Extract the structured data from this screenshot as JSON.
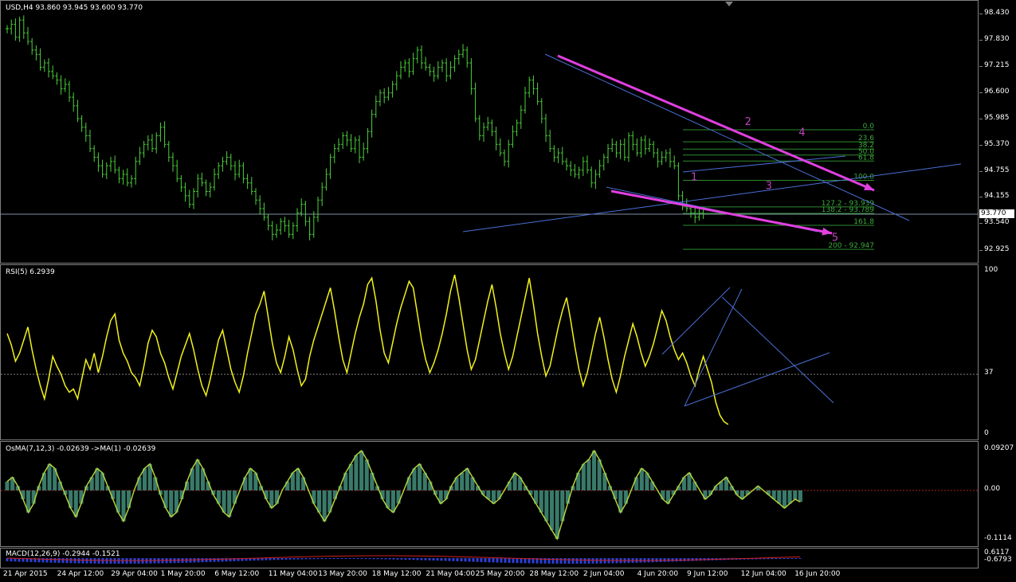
{
  "main": {
    "header": "USD,H4  93.860 93.945 93.600 93.770",
    "price_levels": [
      {
        "label": "98.430",
        "price": 98.43
      },
      {
        "label": "97.830",
        "price": 97.83
      },
      {
        "label": "97.215",
        "price": 97.215
      },
      {
        "label": "96.600",
        "price": 96.6
      },
      {
        "label": "95.985",
        "price": 95.985
      },
      {
        "label": "95.370",
        "price": 95.37
      },
      {
        "label": "94.755",
        "price": 94.755
      },
      {
        "label": "94.155",
        "price": 94.155
      },
      {
        "label": "93.540",
        "price": 93.54
      },
      {
        "label": "92.925",
        "price": 92.925
      }
    ],
    "current_price": "93.770",
    "fib_levels": [
      {
        "label": "0.0",
        "price": 95.74
      },
      {
        "label": "23.6",
        "price": 95.46
      },
      {
        "label": "38.2",
        "price": 95.29
      },
      {
        "label": "50.0",
        "price": 95.15
      },
      {
        "label": "61.8",
        "price": 95.01
      },
      {
        "label": "100.0",
        "price": 94.56
      },
      {
        "label": "127.2 - 93.939",
        "price": 93.94
      },
      {
        "label": "138.2 - 93.789",
        "price": 93.79
      },
      {
        "label": "161.8",
        "price": 93.51
      },
      {
        "label": "200 - 92.947",
        "price": 92.95
      }
    ],
    "wave_labels": [
      {
        "text": "1",
        "price": 94.56,
        "bar": 165
      },
      {
        "text": "2",
        "price": 95.85,
        "bar": 178
      },
      {
        "text": "3",
        "price": 94.36,
        "bar": 183
      },
      {
        "text": "4",
        "price": 95.6,
        "bar": 191
      },
      {
        "text": "5",
        "price": 93.15,
        "bar": 199
      }
    ]
  },
  "rsi": {
    "header": "RSI(5) 6.2939",
    "levels": [
      {
        "label": "100",
        "value": 100
      },
      {
        "label": "37",
        "value": 37
      },
      {
        "label": "0",
        "value": 0
      }
    ]
  },
  "osma": {
    "header": "OsMA(7,12,3) -0.02639  ->MA(1) -0.02639",
    "levels": [
      {
        "label": "0.09207",
        "value": 0.09207
      },
      {
        "label": "0.00",
        "value": 0
      },
      {
        "label": "-0.1114",
        "value": -0.1114
      }
    ]
  },
  "macd": {
    "header": "MACD(12,26,9) -0.2944 -0.1521",
    "levels": [
      {
        "label": "0.6117",
        "value": 0.6117
      },
      {
        "label": "-0.6793",
        "value": -0.6793
      }
    ]
  },
  "time_axis": [
    {
      "label": "21 Apr 2015",
      "bar": 0
    },
    {
      "label": "24 Apr 12:00",
      "bar": 13
    },
    {
      "label": "29 Apr 04:00",
      "bar": 26
    },
    {
      "label": "1 May 20:00",
      "bar": 38
    },
    {
      "label": "6 May 12:00",
      "bar": 51
    },
    {
      "label": "11 May 04:00",
      "bar": 64
    },
    {
      "label": "13 May 20:00",
      "bar": 76
    },
    {
      "label": "18 May 12:00",
      "bar": 89
    },
    {
      "label": "21 May 04:00",
      "bar": 102
    },
    {
      "label": "25 May 20:00",
      "bar": 114
    },
    {
      "label": "28 May 12:00",
      "bar": 127
    },
    {
      "label": "2 Jun 04:00",
      "bar": 140
    },
    {
      "label": "4 Jun 20:00",
      "bar": 153
    },
    {
      "label": "9 Jun 12:00",
      "bar": 165
    },
    {
      "label": "12 Jun 04:00",
      "bar": 178
    },
    {
      "label": "16 Jun 20:00",
      "bar": 191
    }
  ],
  "chart_data": {
    "type": "line",
    "title": "USD,H4",
    "x_unit": "H4 bar index from 21 Apr 2015",
    "close": [
      98.1,
      98.2,
      97.9,
      98.3,
      98.0,
      97.8,
      97.6,
      97.5,
      97.2,
      97.3,
      97.1,
      97.0,
      96.9,
      96.7,
      96.8,
      96.5,
      96.3,
      96.0,
      95.8,
      95.6,
      95.3,
      95.1,
      94.9,
      94.7,
      94.9,
      95.0,
      94.8,
      94.6,
      94.7,
      94.5,
      94.6,
      95.0,
      95.2,
      95.4,
      95.5,
      95.3,
      95.6,
      95.8,
      95.4,
      95.1,
      94.9,
      94.6,
      94.4,
      94.2,
      94.0,
      94.3,
      94.6,
      94.5,
      94.3,
      94.4,
      94.7,
      94.9,
      95.0,
      95.1,
      94.9,
      94.7,
      94.9,
      94.6,
      94.5,
      94.3,
      94.1,
      93.9,
      93.7,
      93.5,
      93.3,
      93.4,
      93.6,
      93.5,
      93.3,
      93.5,
      93.8,
      94.0,
      93.6,
      93.3,
      93.7,
      94.1,
      94.4,
      94.7,
      95.1,
      95.3,
      95.4,
      95.6,
      95.5,
      95.3,
      95.5,
      95.1,
      95.3,
      95.7,
      96.1,
      96.4,
      96.6,
      96.5,
      96.6,
      96.8,
      97.0,
      97.2,
      97.3,
      97.1,
      97.4,
      97.6,
      97.3,
      97.2,
      97.1,
      97.0,
      97.2,
      97.3,
      97.0,
      97.2,
      97.4,
      97.5,
      97.6,
      97.3,
      96.7,
      96.0,
      95.6,
      95.8,
      95.9,
      95.7,
      95.4,
      95.2,
      95.0,
      95.4,
      95.7,
      95.9,
      96.2,
      96.6,
      96.9,
      96.7,
      96.4,
      96.0,
      95.6,
      95.3,
      95.1,
      95.2,
      95.0,
      94.9,
      94.8,
      94.7,
      94.8,
      95.0,
      94.8,
      94.5,
      94.7,
      94.9,
      95.1,
      95.3,
      95.4,
      95.2,
      95.4,
      95.1,
      95.6,
      95.4,
      95.2,
      95.5,
      95.3,
      95.4,
      95.2,
      95.0,
      95.1,
      95.2,
      95.0,
      94.9,
      94.2,
      94.0,
      93.9,
      93.8,
      93.7,
      93.8,
      93.77
    ],
    "rsi": [
      62,
      55,
      45,
      50,
      58,
      66,
      52,
      40,
      30,
      22,
      34,
      48,
      42,
      37,
      30,
      26,
      28,
      22,
      34,
      46,
      40,
      50,
      38,
      48,
      60,
      70,
      74,
      58,
      50,
      45,
      38,
      35,
      30,
      42,
      56,
      64,
      60,
      50,
      44,
      35,
      28,
      38,
      48,
      55,
      62,
      52,
      40,
      30,
      24,
      34,
      46,
      58,
      64,
      52,
      40,
      32,
      26,
      36,
      50,
      62,
      74,
      80,
      88,
      72,
      56,
      44,
      38,
      48,
      60,
      52,
      40,
      30,
      34,
      48,
      58,
      66,
      74,
      82,
      90,
      76,
      60,
      46,
      38,
      50,
      62,
      72,
      80,
      92,
      96,
      82,
      64,
      50,
      44,
      56,
      68,
      78,
      86,
      94,
      90,
      74,
      58,
      46,
      38,
      44,
      52,
      62,
      74,
      88,
      98,
      84,
      68,
      52,
      40,
      46,
      58,
      70,
      82,
      92,
      78,
      62,
      50,
      40,
      48,
      60,
      72,
      84,
      96,
      80,
      62,
      48,
      36,
      42,
      54,
      66,
      76,
      84,
      70,
      54,
      40,
      30,
      38,
      50,
      62,
      72,
      60,
      46,
      34,
      26,
      36,
      48,
      58,
      68,
      60,
      50,
      42,
      48,
      56,
      66,
      76,
      70,
      60,
      52,
      46,
      50,
      44,
      36,
      30,
      40,
      48,
      40,
      32,
      20,
      12,
      8,
      6.3
    ],
    "osma": [
      0.02,
      0.03,
      0.01,
      -0.02,
      -0.05,
      -0.03,
      0.01,
      0.04,
      0.06,
      0.05,
      0.02,
      -0.01,
      -0.04,
      -0.06,
      -0.03,
      0.01,
      0.03,
      0.05,
      0.04,
      0.01,
      -0.02,
      -0.05,
      -0.07,
      -0.04,
      0.0,
      0.03,
      0.05,
      0.06,
      0.03,
      -0.01,
      -0.04,
      -0.06,
      -0.05,
      -0.02,
      0.02,
      0.05,
      0.07,
      0.05,
      0.02,
      -0.01,
      -0.03,
      -0.05,
      -0.06,
      -0.03,
      0.0,
      0.03,
      0.05,
      0.04,
      0.01,
      -0.02,
      -0.04,
      -0.03,
      0.0,
      0.02,
      0.04,
      0.05,
      0.03,
      0.0,
      -0.03,
      -0.05,
      -0.07,
      -0.05,
      -0.02,
      0.01,
      0.04,
      0.06,
      0.08,
      0.09,
      0.07,
      0.04,
      0.01,
      -0.02,
      -0.04,
      -0.05,
      -0.03,
      0.0,
      0.03,
      0.05,
      0.06,
      0.04,
      0.02,
      -0.01,
      -0.03,
      -0.02,
      0.01,
      0.03,
      0.04,
      0.05,
      0.03,
      0.01,
      -0.01,
      -0.02,
      -0.03,
      -0.02,
      0.0,
      0.02,
      0.04,
      0.03,
      0.01,
      -0.01,
      -0.03,
      -0.05,
      -0.07,
      -0.09,
      -0.11,
      -0.07,
      -0.03,
      0.01,
      0.04,
      0.06,
      0.07,
      0.09,
      0.07,
      0.04,
      0.01,
      -0.02,
      -0.05,
      -0.03,
      0.0,
      0.03,
      0.05,
      0.04,
      0.02,
      0.0,
      -0.02,
      -0.03,
      -0.01,
      0.01,
      0.03,
      0.04,
      0.02,
      0.0,
      -0.02,
      -0.01,
      0.01,
      0.02,
      0.03,
      0.01,
      -0.01,
      -0.02,
      -0.01,
      0.0,
      0.01,
      0.0,
      -0.01,
      -0.02,
      -0.03,
      -0.04,
      -0.03,
      -0.02,
      -0.026
    ]
  }
}
